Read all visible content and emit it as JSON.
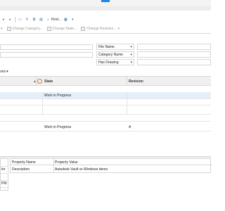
{
  "toolbar": {
    "find_label": "Find...",
    "change_category": "Change Category...",
    "change_state": "Change State...",
    "change_revision": "Change Revision..."
  },
  "search": {
    "properties": [
      {
        "name": "File Name"
      },
      {
        "name": "Category Name"
      },
      {
        "name": "Has Drawing"
      }
    ],
    "options_fragment": "ons"
  },
  "grid": {
    "columns": {
      "state": "State",
      "revision": "Revision"
    },
    "rows": [
      {
        "state": "Work in Progress",
        "revision": "",
        "selected": true
      },
      {
        "state": "Work in Progress",
        "revision": "A",
        "selected": false
      }
    ]
  },
  "bottom_left": {
    "stubs": [
      "ler",
      "PM"
    ]
  },
  "properties_panel": {
    "headers": {
      "name": "Property Name",
      "value": "Property Value"
    },
    "rows": [
      {
        "name": "Description",
        "value": "Autodesk Vault vs Windows demo"
      }
    ]
  }
}
